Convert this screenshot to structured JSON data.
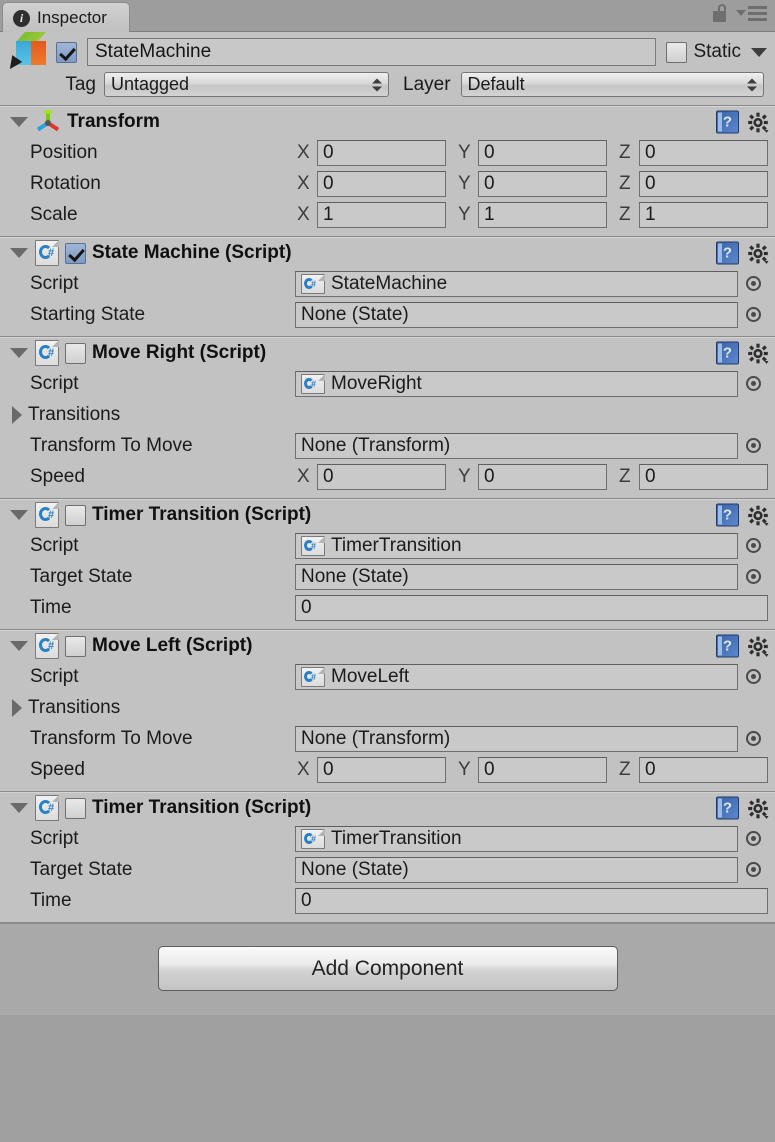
{
  "window": {
    "tab_label": "Inspector",
    "tab_icon": "info-icon",
    "lock_icon": "lock-icon",
    "menu_icon": "hamburger-menu-icon"
  },
  "gameobject": {
    "enabled": true,
    "icon": "gameobject-cube-icon",
    "name": "StateMachine",
    "static_label": "Static",
    "static_checked": false,
    "tag_label": "Tag",
    "tag_value": "Untagged",
    "layer_label": "Layer",
    "layer_value": "Default"
  },
  "components": [
    {
      "id": "transform",
      "icon": "transform-gizmo-icon",
      "title": "Transform",
      "has_checkbox": false,
      "expanded": true,
      "rows": [
        {
          "kind": "vector3",
          "label": "Position",
          "x": "0",
          "y": "0",
          "z": "0"
        },
        {
          "kind": "vector3",
          "label": "Rotation",
          "x": "0",
          "y": "0",
          "z": "0"
        },
        {
          "kind": "vector3",
          "label": "Scale",
          "x": "1",
          "y": "1",
          "z": "1"
        }
      ]
    },
    {
      "id": "state-machine",
      "icon": "csharp-script-icon",
      "title": "State Machine (Script)",
      "has_checkbox": true,
      "checked": true,
      "expanded": true,
      "rows": [
        {
          "kind": "object",
          "label": "Script",
          "value": "StateMachine",
          "has_script_icon": true
        },
        {
          "kind": "object",
          "label": "Starting State",
          "value": "None (State)",
          "has_script_icon": false
        }
      ]
    },
    {
      "id": "move-right",
      "icon": "csharp-script-icon",
      "title": "Move Right (Script)",
      "has_checkbox": true,
      "checked": false,
      "expanded": true,
      "rows": [
        {
          "kind": "object",
          "label": "Script",
          "value": "MoveRight",
          "has_script_icon": true
        },
        {
          "kind": "foldout",
          "label": "Transitions",
          "expanded": false
        },
        {
          "kind": "object",
          "label": "Transform To Move",
          "value": "None (Transform)",
          "has_script_icon": false
        },
        {
          "kind": "vector3",
          "label": "Speed",
          "x": "0",
          "y": "0",
          "z": "0"
        }
      ]
    },
    {
      "id": "timer-transition-1",
      "icon": "csharp-script-icon",
      "title": "Timer Transition (Script)",
      "has_checkbox": true,
      "checked": false,
      "expanded": true,
      "rows": [
        {
          "kind": "object",
          "label": "Script",
          "value": "TimerTransition",
          "has_script_icon": true
        },
        {
          "kind": "object",
          "label": "Target State",
          "value": "None (State)",
          "has_script_icon": false
        },
        {
          "kind": "text",
          "label": "Time",
          "value": "0"
        }
      ]
    },
    {
      "id": "move-left",
      "icon": "csharp-script-icon",
      "title": "Move Left (Script)",
      "has_checkbox": true,
      "checked": false,
      "expanded": true,
      "rows": [
        {
          "kind": "object",
          "label": "Script",
          "value": "MoveLeft",
          "has_script_icon": true
        },
        {
          "kind": "foldout",
          "label": "Transitions",
          "expanded": false
        },
        {
          "kind": "object",
          "label": "Transform To Move",
          "value": "None (Transform)",
          "has_script_icon": false
        },
        {
          "kind": "vector3",
          "label": "Speed",
          "x": "0",
          "y": "0",
          "z": "0"
        }
      ]
    },
    {
      "id": "timer-transition-2",
      "icon": "csharp-script-icon",
      "title": "Timer Transition (Script)",
      "has_checkbox": true,
      "checked": false,
      "expanded": true,
      "rows": [
        {
          "kind": "object",
          "label": "Script",
          "value": "TimerTransition",
          "has_script_icon": true
        },
        {
          "kind": "object",
          "label": "Target State",
          "value": "None (State)",
          "has_script_icon": false
        },
        {
          "kind": "text",
          "label": "Time",
          "value": "0"
        }
      ]
    }
  ],
  "axes": {
    "x": "X",
    "y": "Y",
    "z": "Z"
  },
  "component_tools": {
    "help_icon": "help-book-icon",
    "settings_icon": "gear-icon"
  },
  "footer": {
    "add_component_label": "Add Component"
  },
  "colors": {
    "panel_bg": "#c2c2c2",
    "window_bg": "#a0a0a0",
    "field_bg": "#c9c9c9",
    "accent_blue": "#3b63a8",
    "axis_green": "#7ac70c",
    "axis_red": "#e0342c",
    "axis_blue": "#2b9fe0"
  }
}
